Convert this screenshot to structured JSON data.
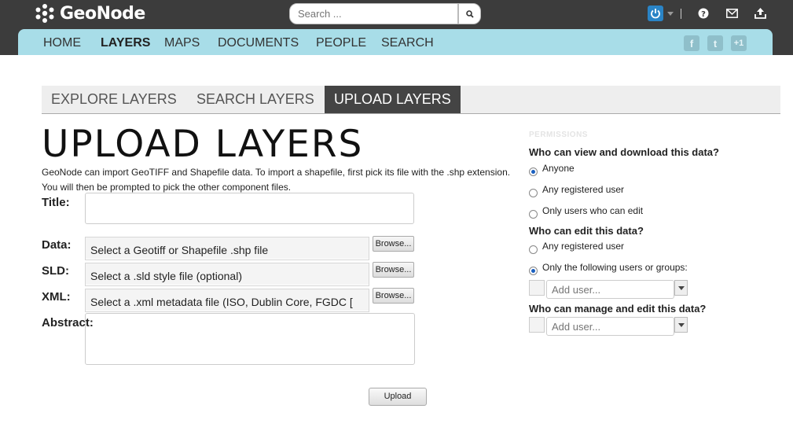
{
  "brand": {
    "name": "GeoNode"
  },
  "search": {
    "placeholder": "Search ..."
  },
  "nav": {
    "items": [
      {
        "label": "HOME"
      },
      {
        "label": "LAYERS"
      },
      {
        "label": "MAPS"
      },
      {
        "label": "DOCUMENTS"
      },
      {
        "label": "PEOPLE"
      },
      {
        "label": "SEARCH"
      }
    ],
    "active": "LAYERS",
    "social": {
      "facebook": "f",
      "twitter": "t",
      "plusone": "+1"
    }
  },
  "tabs": [
    {
      "label": "EXPLORE LAYERS"
    },
    {
      "label": "SEARCH LAYERS"
    },
    {
      "label": "UPLOAD LAYERS"
    }
  ],
  "page": {
    "title": "UPLOAD LAYERS",
    "intro": "GeoNode can import GeoTIFF and Shapefile data. To import a shapefile, first pick its file with the .shp extension. You will then be prompted to pick the other component files."
  },
  "form": {
    "title_label": "Title:",
    "title_value": "",
    "data_label": "Data:",
    "data_placeholder": "Select a Geotiff or Shapefile .shp file",
    "sld_label": "SLD:",
    "sld_placeholder": "Select a .sld style file (optional)",
    "xml_label": "XML:",
    "xml_placeholder": "Select a .xml metadata file (ISO, Dublin Core, FGDC [",
    "abstract_label": "Abstract:",
    "abstract_value": "",
    "browse_label": "Browse...",
    "upload_label": "Upload"
  },
  "permissions": {
    "heading": "PERMISSIONS",
    "view_question": "Who can view and download this data?",
    "view_options": [
      "Anyone",
      "Any registered user",
      "Only users who can edit"
    ],
    "view_selected": "Anyone",
    "edit_question": "Who can edit this data?",
    "edit_options": [
      "Any registered user",
      "Only the following users or groups:"
    ],
    "edit_selected": "Only the following users or groups:",
    "add_user_placeholder": "Add user...",
    "manage_question": "Who can manage and edit this data?"
  },
  "colors": {
    "topbar": "#3c3c3c",
    "navbar": "#a8dde8",
    "active_tab": "#444444",
    "accent_blue": "#2a84c6"
  }
}
